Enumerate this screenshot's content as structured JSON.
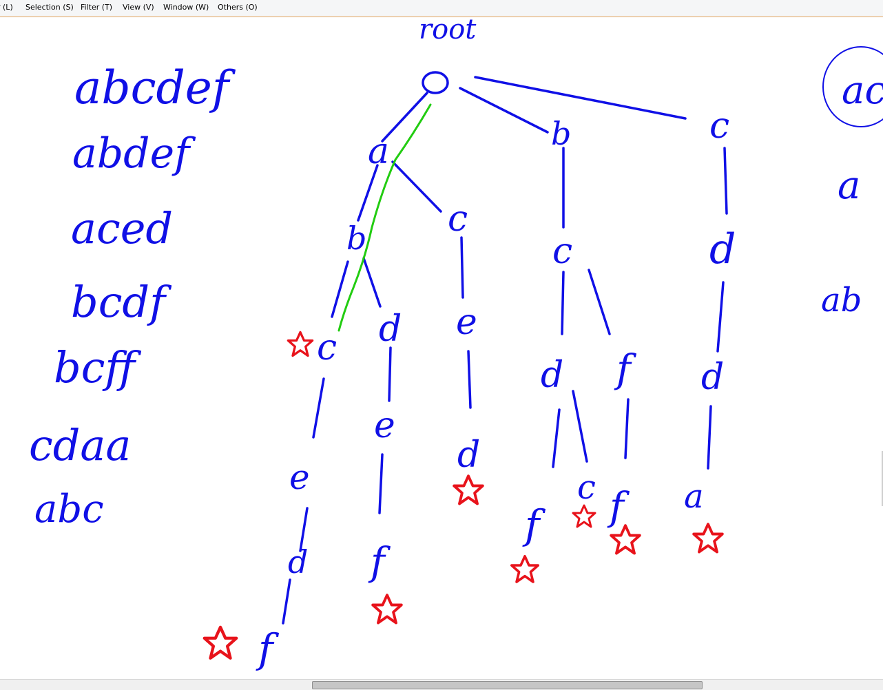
{
  "menu": {
    "items": [
      {
        "label": "r (L)"
      },
      {
        "label": "Selection (S)"
      },
      {
        "label": "Filter (T)"
      },
      {
        "label": "View (V)"
      },
      {
        "label": "Window (W)"
      },
      {
        "label": "Others (O)"
      }
    ]
  },
  "whiteboard": {
    "root_label": "root",
    "words": [
      "abcdef",
      "abdef",
      "aced",
      "bcdf",
      "bcff",
      "cdaa",
      "abc"
    ],
    "tree_letters": [
      "a",
      "b",
      "c",
      "b",
      "c",
      "c",
      "d",
      "c",
      "d",
      "e",
      "d",
      "f",
      "d",
      "e",
      "d",
      "a",
      "e",
      "f",
      "f",
      "d",
      "f",
      "c",
      "f",
      "a"
    ],
    "right_cut_text": [
      "ac",
      "a",
      "ab"
    ]
  },
  "colors": {
    "ink": "#1010e6",
    "star": "#e8131b",
    "highlight_path": "#22cc11",
    "menu_border": "#e3a35b"
  }
}
